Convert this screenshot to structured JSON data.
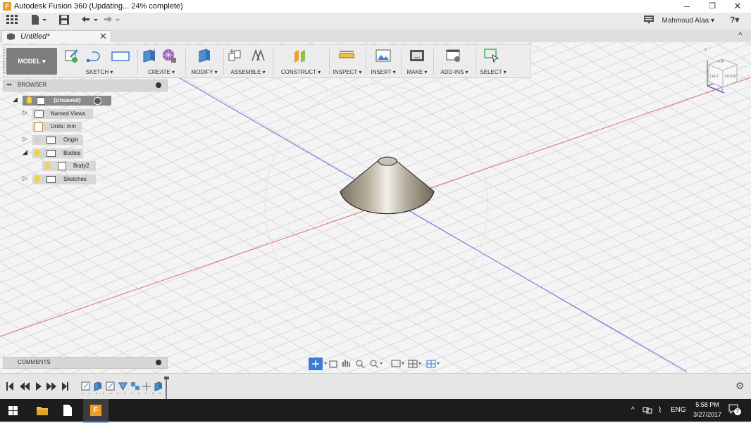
{
  "window": {
    "title": "Autodesk Fusion 360 (Updating... 24% complete)",
    "progress_percent": 24,
    "minimize_glyph": "–",
    "restore_glyph": "❐",
    "close_glyph": "✕"
  },
  "appbar": {
    "user_name": "Mahmoud Alaa ▾",
    "help_glyph": "?▾"
  },
  "tab": {
    "name": "Untitled*",
    "close_glyph": "✕",
    "collapse_glyph": "^"
  },
  "toolbar": {
    "workspace": "MODEL ▾",
    "groups": [
      {
        "label": "SKETCH ▾"
      },
      {
        "label": "CREATE ▾"
      },
      {
        "label": "MODIFY ▾"
      },
      {
        "label": "ASSEMBLE ▾"
      },
      {
        "label": "CONSTRUCT ▾"
      },
      {
        "label": "INSPECT ▾"
      },
      {
        "label": "INSERT ▾"
      },
      {
        "label": "MAKE ▾"
      },
      {
        "label": "ADD-INS ▾"
      },
      {
        "label": "SELECT ▾"
      }
    ]
  },
  "browser": {
    "title": "BROWSER",
    "collapse_glyph": "◂◂",
    "items": [
      {
        "label": "(Unsaved)"
      },
      {
        "label": "Named Views"
      },
      {
        "label": "Units: mm"
      },
      {
        "label": "Origin"
      },
      {
        "label": "Bodies"
      },
      {
        "label": "Body2"
      },
      {
        "label": "Sketches"
      }
    ]
  },
  "comments": {
    "title": "COMMENTS"
  },
  "viewcube": {
    "top": "TOP",
    "left": "LEFT",
    "front": "FRONT",
    "axis_y": "Y",
    "axis_z": "Z"
  },
  "taskbar": {
    "language": "ENG",
    "time": "5:58 PM",
    "date": "3/27/2017",
    "notification_count": "2"
  },
  "colors": {
    "x_axis": "#e05050",
    "z_axis": "#5a5ad8",
    "grid": "#d8d8dc",
    "model_button": "#7d7d7d",
    "highlight_tree": "#8a8a8a"
  }
}
